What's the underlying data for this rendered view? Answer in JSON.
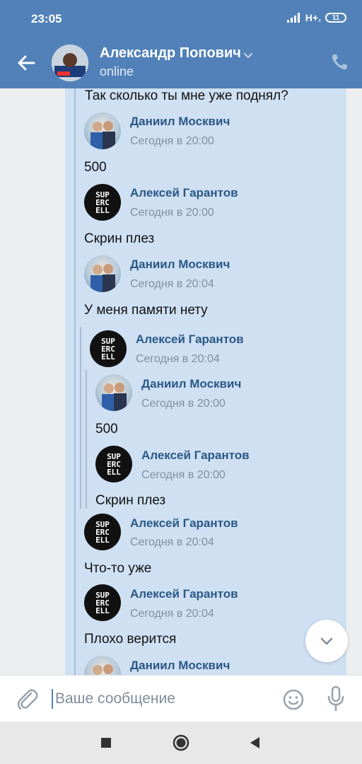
{
  "status_bar": {
    "time": "23:05",
    "network": "H+",
    "network_sub": "₂",
    "battery": "11"
  },
  "header": {
    "contact_name": "Александр Попович",
    "contact_status": "online",
    "icons": {
      "back": "arrow-left-icon",
      "dropdown": "chevron-down-icon",
      "call": "phone-icon"
    }
  },
  "chat": {
    "top_text": "Так сколько ты мне уже поднял?",
    "messages": [
      {
        "author": "Даниил Москвич",
        "time": "Сегодня в 20:00",
        "text": "500",
        "avatar": "photo"
      },
      {
        "author": "Алексей Гарантов",
        "time": "Сегодня в 20:00",
        "text": "Скрин плез",
        "avatar": "supercell"
      },
      {
        "author": "Даниил Москвич",
        "time": "Сегодня в 20:04",
        "text": "У меня памяти нету",
        "avatar": "photo"
      }
    ],
    "nested": {
      "author": "Алексей Гарантов",
      "time": "Сегодня в 20:04",
      "avatar": "supercell",
      "inner": [
        {
          "author": "Даниил Москвич",
          "time": "Сегодня в 20:00",
          "text": "500",
          "avatar": "photo"
        },
        {
          "author": "Алексей Гарантов",
          "time": "Сегодня в 20:00",
          "text": "Скрин плез",
          "avatar": "supercell"
        }
      ]
    },
    "after": [
      {
        "author": "Алексей Гарантов",
        "time": "Сегодня в 20:04",
        "text": "Что-то уже",
        "avatar": "supercell"
      },
      {
        "author": "Алексей Гарантов",
        "time": "Сегодня в 20:04",
        "text": "Плохо верится",
        "avatar": "supercell"
      },
      {
        "author": "Даниил Москвич",
        "avatar": "photo"
      }
    ],
    "supercell_logo": [
      "SUP",
      "ERC",
      "ELL"
    ]
  },
  "composer": {
    "placeholder": "Ваше сообщение",
    "icons": {
      "attach": "paperclip-icon",
      "emoji": "smiley-icon",
      "mic": "microphone-icon"
    }
  },
  "colors": {
    "header": "#5181b8",
    "bubble": "#cfe0f3",
    "author": "#2a5885",
    "time": "#7f8fa3"
  }
}
